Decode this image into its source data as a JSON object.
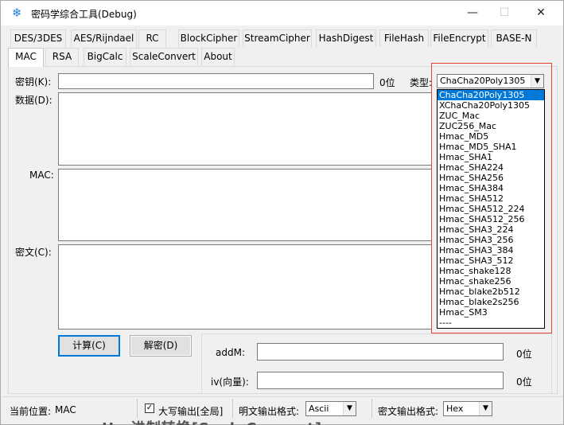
{
  "window": {
    "title": "密码学综合工具(Debug)",
    "icon": "snowflake-icon",
    "controls": {
      "minimize": "—",
      "maximize": "☐",
      "close": "✕"
    }
  },
  "tabs_row1": [
    "DES/3DES",
    "AES/Rijndael",
    "RC",
    "BlockCipher",
    "StreamCipher",
    "HashDigest",
    "FileHash",
    "FileEncrypt",
    "BASE-N"
  ],
  "tabs_row2": [
    "MAC",
    "RSA",
    "BigCalc",
    "ScaleConvert",
    "About"
  ],
  "active_tab": "MAC",
  "form": {
    "key_label": "密钥(K):",
    "key_value": "",
    "key_bits": "0位",
    "type_label": "类型:",
    "type_selected": "ChaCha20Poly1305",
    "data_label": "数据(D):",
    "mac_label": "MAC:",
    "cipher_label": "密文(C):",
    "compute_button": "计算(C)",
    "decrypt_button": "解密(D)",
    "addm_label": "addM:",
    "addm_bits": "0位",
    "iv_label": "iv(向量):",
    "iv_bits": "0位"
  },
  "type_options": [
    "ChaCha20Poly1305",
    "XChaCha20Poly1305",
    "ZUC_Mac",
    "ZUC256_Mac",
    "Hmac_MD5",
    "Hmac_MD5_SHA1",
    "Hmac_SHA1",
    "Hmac_SHA224",
    "Hmac_SHA256",
    "Hmac_SHA384",
    "Hmac_SHA512",
    "Hmac_SHA512_224",
    "Hmac_SHA512_256",
    "Hmac_SHA3_224",
    "Hmac_SHA3_256",
    "Hmac_SHA3_384",
    "Hmac_SHA3_512",
    "Hmac_shake128",
    "Hmac_shake256",
    "Hmac_blake2b512",
    "Hmac_blake2s256",
    "Hmac_SM3",
    "----"
  ],
  "statusbar": {
    "location_label": "当前位置:",
    "location_value": "MAC",
    "uppercase_label": "大写输出[全局]",
    "uppercase_checked": "✓",
    "plain_format_label": "明文输出格式:",
    "plain_format_value": "Ascii",
    "cipher_format_label": "密文输出格式:",
    "cipher_format_value": "Hex"
  },
  "background_text": "Ho 进制转换[ScaleConvert]",
  "colors": {
    "accent": "#0078d7",
    "annotation": "#e8443a"
  }
}
